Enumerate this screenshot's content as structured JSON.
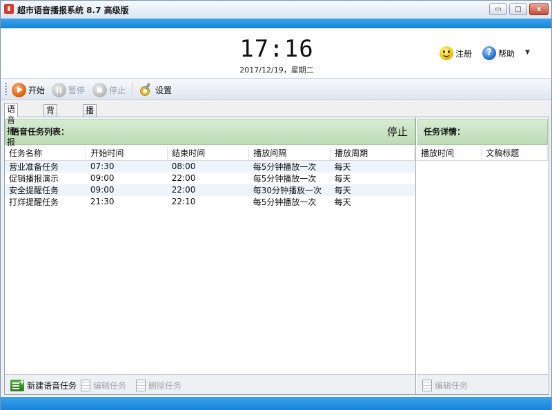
{
  "window": {
    "title": "超市语音播报系统 8.7 高级版",
    "controls": {
      "minimize": "▭",
      "maximize": "□",
      "close": "x"
    }
  },
  "header": {
    "clock": "17:16",
    "date": "2017/12/19，星期二",
    "register_label": "注册",
    "help_label": "帮助",
    "help_arrow": "▼"
  },
  "toolbar": {
    "start_label": "开始",
    "pause_label": "暂停",
    "stop_label": "停止",
    "settings_label": "设置"
  },
  "tabs": [
    "语音播报",
    "背景音乐",
    "播音员管理"
  ],
  "task_list": {
    "title": "语音任务列表：",
    "status": "停止",
    "columns": [
      "任务名称",
      "开始时间",
      "结束时间",
      "播放间隔",
      "播放周期"
    ],
    "rows": [
      [
        "营业准备任务",
        "07:30",
        "08:00",
        "每5分钟播放一次",
        "每天"
      ],
      [
        "促销播报演示",
        "09:00",
        "22:00",
        "每5分钟播放一次",
        "每天"
      ],
      [
        "安全提醒任务",
        "09:00",
        "22:00",
        "每30分钟播放一次",
        "每天"
      ],
      [
        "打烊提醒任务",
        "21:30",
        "22:10",
        "每5分钟播放一次",
        "每天"
      ]
    ],
    "footer": {
      "new_label": "新建语音任务",
      "edit_label": "编辑任务",
      "delete_label": "删除任务"
    }
  },
  "task_detail": {
    "title": "任务详情：",
    "columns": [
      "播放时间",
      "文稿标题"
    ],
    "footer": {
      "edit_label": "编辑任务"
    }
  },
  "colors": {
    "accent_blue": "#1684d8",
    "group_header_green": "#bcdcb4"
  }
}
